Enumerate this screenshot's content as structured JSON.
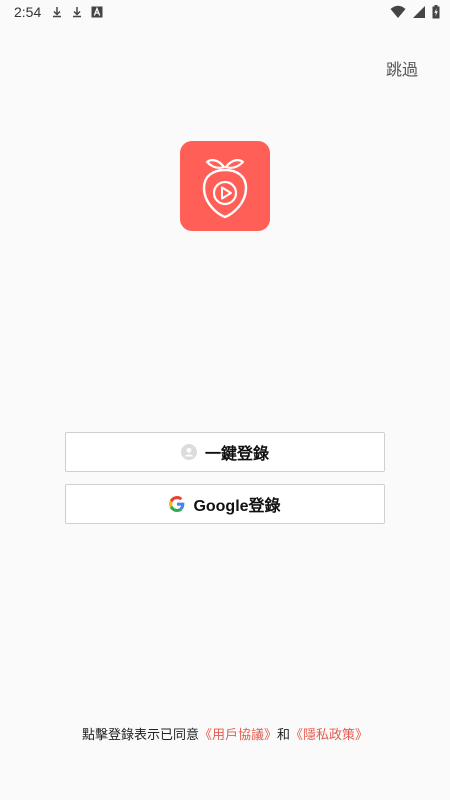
{
  "status_bar": {
    "time": "2:54",
    "left_icons": [
      "download-icon",
      "download-icon",
      "accessibility-a-icon"
    ],
    "right_icons": [
      "wifi-icon",
      "cell-signal-icon",
      "battery-charging-icon"
    ]
  },
  "header": {
    "skip_label": "跳過"
  },
  "app_icon": {
    "name": "strawberry-play-logo",
    "bg_color": "#ff5f57"
  },
  "buttons": {
    "one_click_label": "一鍵登錄",
    "google_label": "Google登錄",
    "one_click_icon": "user-circle-icon",
    "google_icon": "google-g-icon"
  },
  "footer": {
    "prefix": "點擊登錄表示已同意",
    "user_agreement": "《用戶協議》",
    "and": "和",
    "privacy_policy": "《隱私政策》",
    "link_color": "#e45b4f"
  }
}
